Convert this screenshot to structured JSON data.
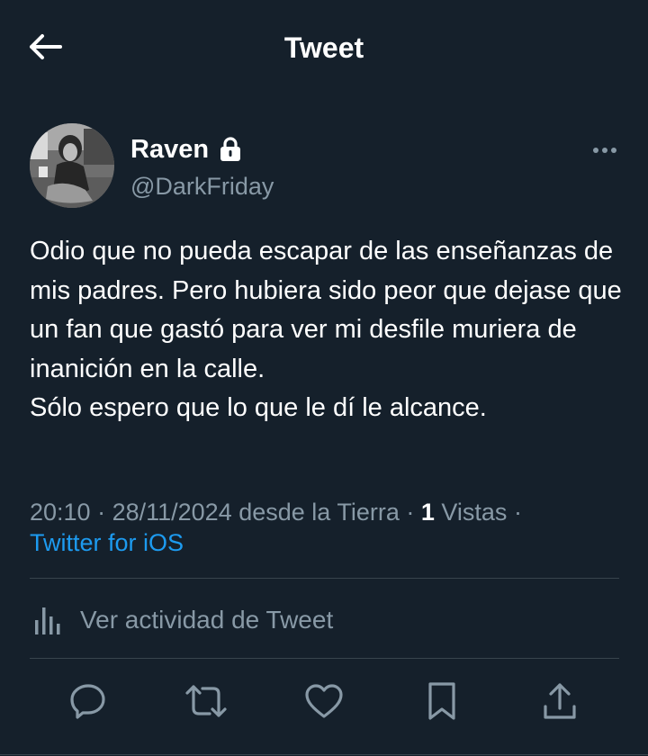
{
  "header": {
    "title": "Tweet",
    "back_icon": "arrow-left-icon"
  },
  "author": {
    "display_name": "Raven",
    "handle": "@DarkFriday",
    "protected_icon": "lock-icon",
    "avatar": "user-avatar-photo",
    "more_icon": "more-horizontal-icon"
  },
  "tweet": {
    "lines": [
      "Odio que no pueda escapar de las enseñanzas de mis padres. Pero hubiera sido peor que dejase que un fan que gastó para ver mi desfile muriera de inanición en la calle.",
      "Sólo espero que lo que le dí le alcance."
    ]
  },
  "meta": {
    "time": "20:10",
    "separator": " · ",
    "date": "28/11/2024",
    "location": "desde la Tierra",
    "views_count": "1",
    "views_label": "Vistas",
    "source": "Twitter for iOS"
  },
  "activity": {
    "label": "Ver actividad de Tweet",
    "icon": "bar-chart-icon"
  },
  "actions": [
    {
      "name": "reply",
      "icon": "reply-icon"
    },
    {
      "name": "retweet",
      "icon": "retweet-icon"
    },
    {
      "name": "like",
      "icon": "heart-icon"
    },
    {
      "name": "bookmark",
      "icon": "bookmark-icon"
    },
    {
      "name": "share",
      "icon": "share-icon"
    }
  ],
  "colors": {
    "background": "#15202b",
    "text_primary": "#ffffff",
    "text_secondary": "#8899a6",
    "link": "#1d9bf0",
    "divider": "#38444d"
  }
}
